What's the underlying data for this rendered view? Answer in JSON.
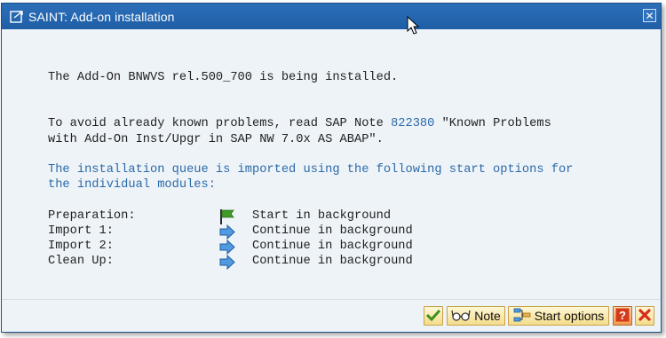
{
  "window": {
    "title": "SAINT: Add-on installation",
    "close_symbol": "✕"
  },
  "messages": {
    "line1": "The Add-On BNWVS rel.500_700 is being installed.",
    "line2_prefix": "To avoid already known problems, read SAP Note ",
    "note_number": "822380",
    "line2_suffix": " \"Known Problems",
    "line3": "with Add-On Inst/Upgr in SAP NW 7.0x AS ABAP\".",
    "line4": "The installation queue is imported using the following start options for",
    "line5": "the individual modules:"
  },
  "options": [
    {
      "label": "Preparation:",
      "icon": "green-flag-icon",
      "value": "Start in background"
    },
    {
      "label": "Import 1:",
      "icon": "blue-arrow-icon",
      "value": "Continue in background"
    },
    {
      "label": "Import 2:",
      "icon": "blue-arrow-icon",
      "value": "Continue in background"
    },
    {
      "label": "Clean Up:",
      "icon": "blue-arrow-icon",
      "value": "Continue in background"
    }
  ],
  "toolbar": {
    "confirm_icon": "checkmark-icon",
    "note_label": "Note",
    "start_options_label": "Start options",
    "help_icon": "help-icon",
    "cancel_icon": "cancel-icon"
  },
  "colors": {
    "titlebar": "#1e5ea6",
    "link_blue": "#2b6aa8",
    "background": "#eef3f8",
    "button_border": "#c9a24c"
  }
}
